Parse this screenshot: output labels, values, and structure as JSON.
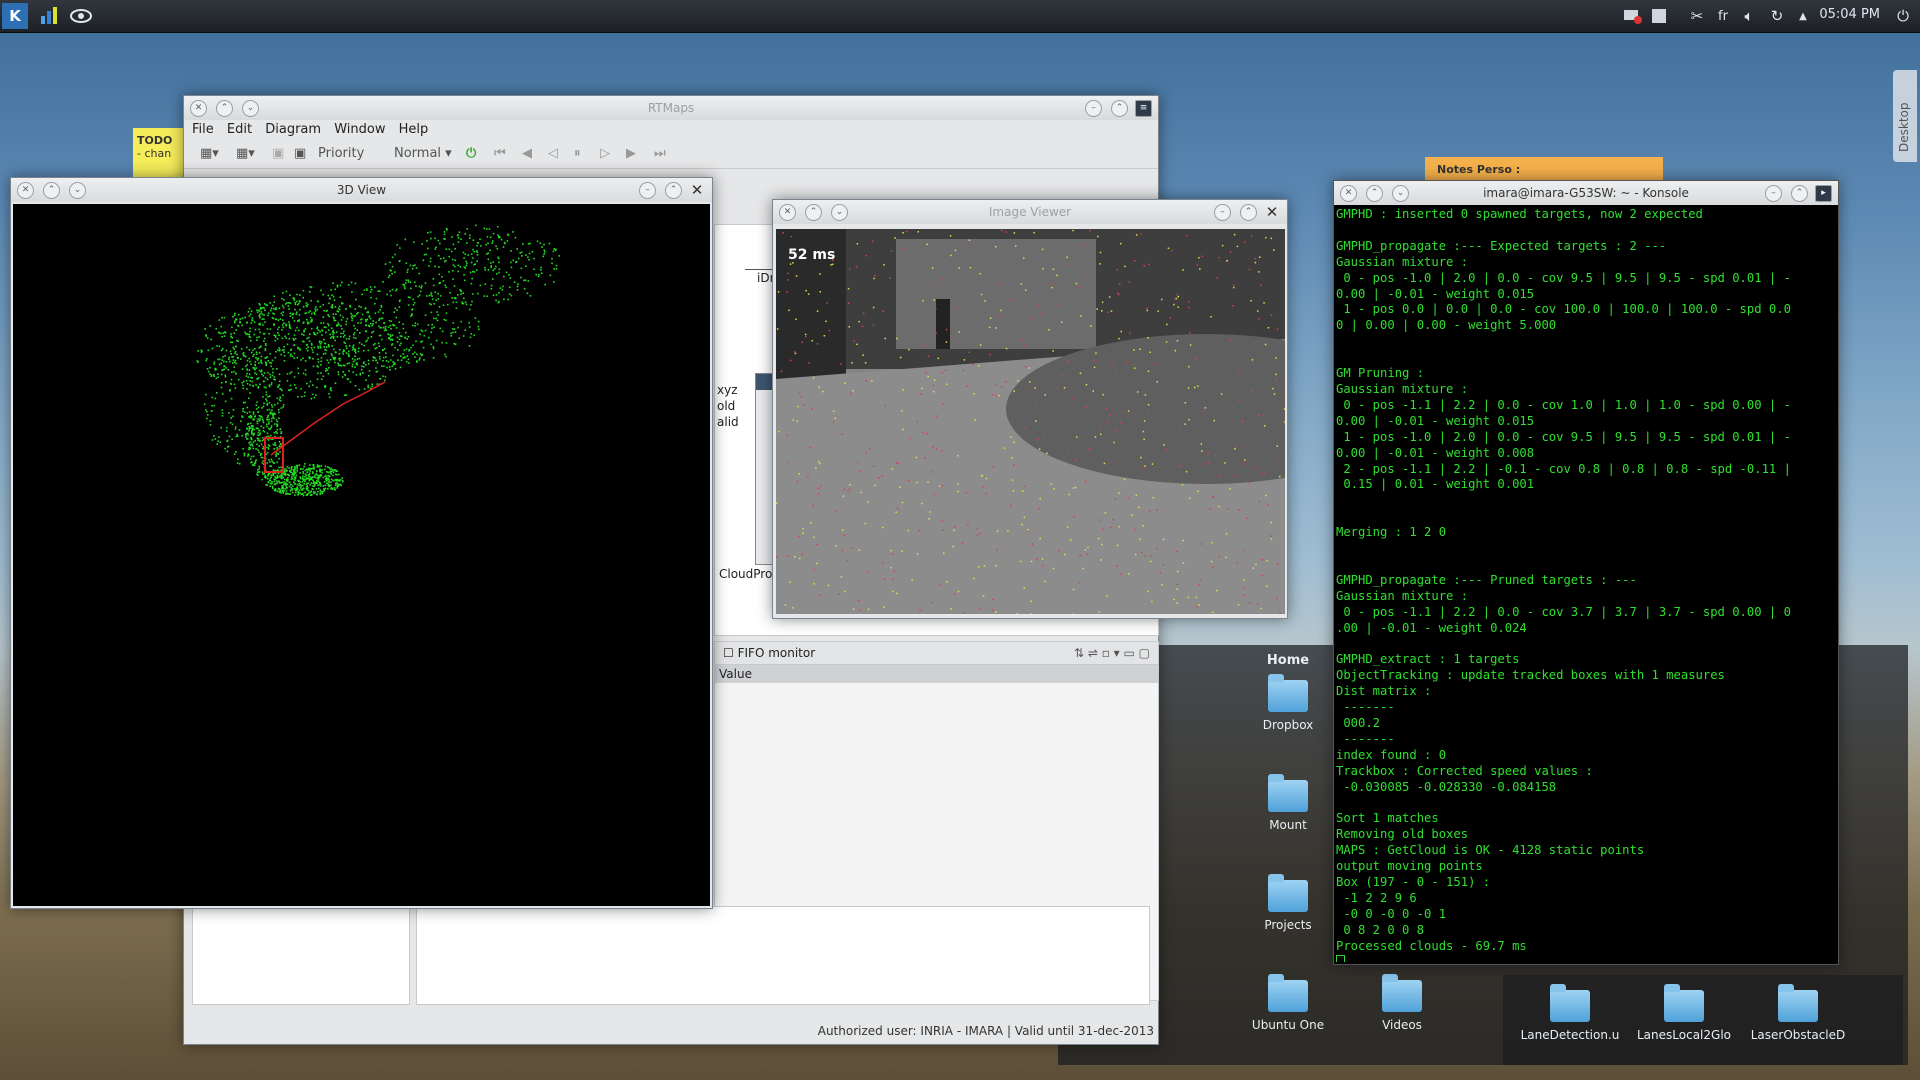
{
  "panel": {
    "icons": [
      "kde-menu-icon",
      "system-monitor-icon",
      "eye-app-icon"
    ],
    "tray_lang": "fr",
    "clock": "05:04 PM"
  },
  "desktop": {
    "todo_title": "TODO",
    "todo_line": "- chan",
    "notes_title": "Notes Perso :",
    "desktop_tab": "Desktop"
  },
  "rtmaps": {
    "title": "RTMaps",
    "menu": [
      "File",
      "Edit",
      "Diagram",
      "Window",
      "Help"
    ],
    "priority_label": "Priority",
    "priority_value": "Normal",
    "diagram_labels": [
      "iDraw",
      "xyz",
      "old",
      "alid",
      "CloudPro"
    ],
    "fifo_title": "FIFO monitor",
    "fifo_column": "Value",
    "status": "Authorized user: INRIA - IMARA | Valid until 31-dec-2013"
  },
  "view3d": {
    "title": "3D View"
  },
  "image_viewer": {
    "title": "Image Viewer",
    "fps_label": "52 ms"
  },
  "konsole": {
    "title": "imara@imara-G53SW: ~ - Konsole",
    "lines": [
      "GMPHD : inserted 0 spawned targets, now 2 expected",
      "",
      "GMPHD_propagate :--- Expected targets : 2 ---",
      "Gaussian mixture :",
      " 0 - pos -1.0 | 2.0 | 0.0 - cov 9.5 | 9.5 | 9.5 - spd 0.01 | -",
      "0.00 | -0.01 - weight 0.015",
      " 1 - pos 0.0 | 0.0 | 0.0 - cov 100.0 | 100.0 | 100.0 - spd 0.0",
      "0 | 0.00 | 0.00 - weight 5.000",
      "",
      "",
      "GM Pruning :",
      "Gaussian mixture :",
      " 0 - pos -1.1 | 2.2 | 0.0 - cov 1.0 | 1.0 | 1.0 - spd 0.00 | -",
      "0.00 | -0.01 - weight 0.015",
      " 1 - pos -1.0 | 2.0 | 0.0 - cov 9.5 | 9.5 | 9.5 - spd 0.01 | -",
      "0.00 | -0.01 - weight 0.008",
      " 2 - pos -1.1 | 2.2 | -0.1 - cov 0.8 | 0.8 | 0.8 - spd -0.11 |",
      " 0.15 | 0.01 - weight 0.001",
      "",
      "",
      "Merging : 1 2 0",
      "",
      "",
      "GMPHD_propagate :--- Pruned targets : ---",
      "Gaussian mixture :",
      " 0 - pos -1.1 | 2.2 | 0.0 - cov 3.7 | 3.7 | 3.7 - spd 0.00 | 0",
      ".00 | -0.01 - weight 0.024",
      "",
      "GMPHD_extract : 1 targets",
      "ObjectTracking : update tracked boxes with 1 measures",
      "Dist matrix :",
      " -------",
      " 000.2",
      " -------",
      "index found : 0",
      "Trackbox : Corrected speed values :",
      " -0.030085 -0.028330 -0.084158",
      "",
      "Sort 1 matches",
      "Removing old boxes",
      "MAPS : GetCloud is OK - 4128 static points",
      "output moving points",
      "Box (197 - 0 - 151) :",
      " -1 2 2 9 6",
      " -0 0 -0 0 -0 1",
      " 0 8 2 0 0 8",
      "Processed clouds - 69.7 ms"
    ]
  },
  "folderview": {
    "title": "Home",
    "items": [
      {
        "label": "Dropbox",
        "icon": "dropbox-icon"
      },
      {
        "label": "Mount",
        "icon": "folder-icon"
      },
      {
        "label": "Projects",
        "icon": "folder-icon"
      },
      {
        "label": "Ubuntu One",
        "icon": "ubuntu-one-icon"
      },
      {
        "label": "Videos",
        "icon": "videos-icon"
      },
      {
        "label": "LaneDetection.u",
        "icon": "folder-icon"
      },
      {
        "label": "LanesLocal2Glo",
        "icon": "folder-icon"
      },
      {
        "label": "LaserObstacleD",
        "icon": "folder-icon"
      }
    ]
  },
  "colors": {
    "terminal_green": "#2fe02f",
    "points_green": "#22dd22",
    "trajectory_red": "#e02020"
  }
}
